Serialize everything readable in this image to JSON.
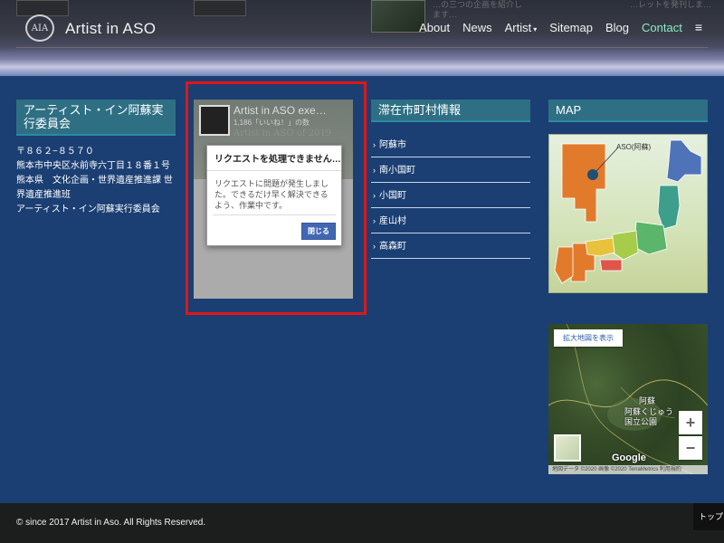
{
  "header": {
    "logo_text": "AIA",
    "site_title": "Artist in ASO",
    "bg_text_1": "…の三つの企画を紹介します…",
    "bg_text_2": "…レットを発刊しま…",
    "nav": [
      {
        "label": "About"
      },
      {
        "label": "News"
      },
      {
        "label": "Artist",
        "caret": "▾"
      },
      {
        "label": "Sitemap"
      },
      {
        "label": "Blog"
      },
      {
        "label": "Contact"
      }
    ],
    "menu_icon": "≡"
  },
  "organization": {
    "heading": "アーティスト・イン阿蘇実行委員会",
    "address_lines": [
      "〒８６２−８５７０",
      "熊本市中央区水前寺六丁目１８番１号",
      "熊本県　文化企画・世界遺産推進課 世界遺産推進班",
      "アーティスト・イン阿蘇実行委員会"
    ]
  },
  "facebook_widget": {
    "page_name": "Artist in ASO exe…",
    "likes": "1,186「いいね！」の数",
    "ghost_text": "Artist in ASO of 2019",
    "dialog": {
      "title": "リクエストを処理できません…",
      "body": "リクエストに問題が発生しました。できるだけ早く解決できるよう、作業中です。",
      "close_label": "閉じる"
    }
  },
  "municipalities": {
    "heading": "滞在市町村情報",
    "items": [
      "阿蘇市",
      "南小国町",
      "小国町",
      "産山村",
      "高森町"
    ]
  },
  "map": {
    "heading": "MAP",
    "pin_label": "ASO(阿蘇)",
    "google_map": {
      "enlarge_label": "拡大地図を表示",
      "zoom_in": "+",
      "zoom_out": "−",
      "place_aso": "阿蘇",
      "place_park": "阿蘇くじゅう国立公園",
      "logo": "Google",
      "attribution": "地図データ ©2020 画像 ©2020 TerraMetrics 利用規約"
    }
  },
  "footer": {
    "copyright": "© since 2017 Artist in Aso. All Rights Reserved.",
    "to_top": "トップ"
  },
  "colors": {
    "page_bg": "#1b3f73",
    "heading_bg": "#2e6f84",
    "nav_active": "#8ee8c6",
    "highlight": "#e01616",
    "fb_button": "#4267b2",
    "footer_bg": "#1c1e1e"
  }
}
